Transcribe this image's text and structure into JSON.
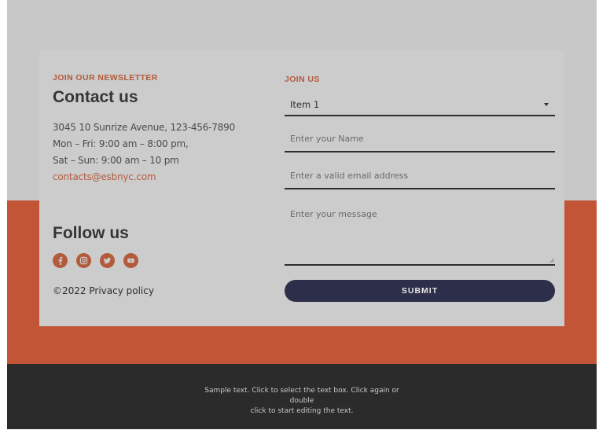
{
  "newsletter": {
    "eyebrow": "JOIN OUR NEWSLETTER",
    "heading": "Contact us",
    "address": "3045 10 Sunrize Avenue, 123-456-7890",
    "hours_weekday": "Mon – Fri: 9:00 am – 8:00 pm,",
    "hours_weekend": "Sat – Sun: 9:00 am – 10 pm",
    "email": "contacts@esbnyc.com"
  },
  "follow": {
    "heading": "Follow us",
    "socials": [
      {
        "icon": "facebook-icon"
      },
      {
        "icon": "instagram-icon"
      },
      {
        "icon": "twitter-icon"
      },
      {
        "icon": "youtube-icon"
      }
    ],
    "copyright": "©2022 Privacy policy"
  },
  "form": {
    "eyebrow": "JOIN US",
    "select_value": "Item 1",
    "name_placeholder": "Enter your Name",
    "email_placeholder": "Enter a valid email address",
    "message_placeholder": "Enter your message",
    "submit_label": "SUBMIT"
  },
  "footer": {
    "line1": "Sample text. Click to select the text box. Click again or double",
    "line2": "click to start editing the text."
  },
  "colors": {
    "accent": "#b35a3b",
    "band": "#c25535",
    "button": "#2d2f4a",
    "footer": "#2b2b2b",
    "background": "#c8c8c8"
  }
}
